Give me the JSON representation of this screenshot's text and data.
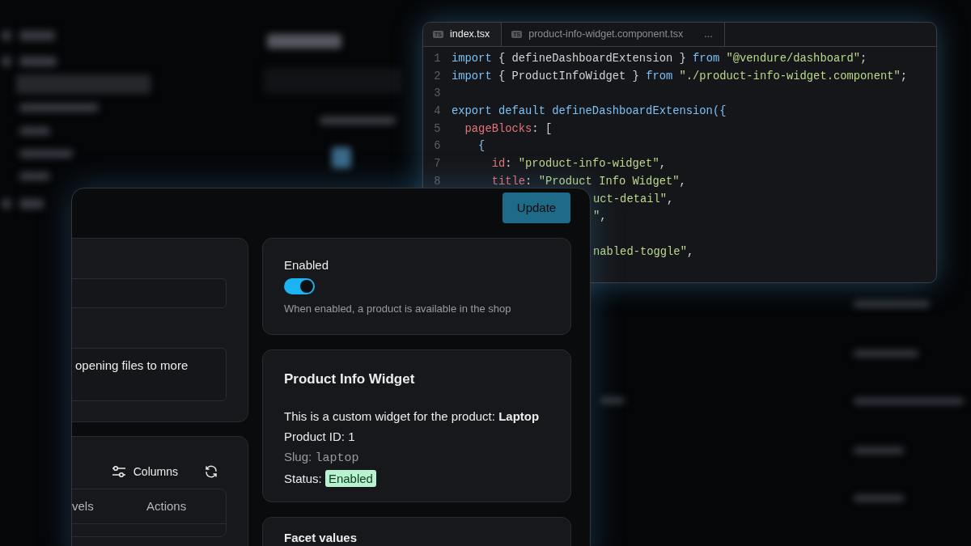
{
  "editor": {
    "tabs": [
      {
        "icon_label": "TS",
        "label": "index.tsx",
        "selected": true
      },
      {
        "icon_label": "TS",
        "label": "product-info-widget.component.tsx",
        "selected": false
      }
    ],
    "tab_overflow": "...",
    "lines": [
      {
        "kind": "full",
        "number": "1",
        "tokens": [
          {
            "kind": "keyword",
            "text": "import"
          },
          {
            "kind": "plain",
            "text": " { defineDashboardExtension } "
          },
          {
            "kind": "keyword",
            "text": "from"
          },
          {
            "kind": "string",
            "text": " \"@vendure/dashboard\""
          },
          {
            "kind": "plain",
            "text": ";"
          }
        ]
      },
      {
        "kind": "full",
        "number": "2",
        "tokens": [
          {
            "kind": "keyword",
            "text": "import"
          },
          {
            "kind": "plain",
            "text": " { ProductInfoWidget } "
          },
          {
            "kind": "keyword",
            "text": "from"
          },
          {
            "kind": "string",
            "text": " \"./product-info-widget.component\""
          },
          {
            "kind": "plain",
            "text": ";"
          }
        ]
      },
      {
        "kind": "full",
        "number": "3"
      },
      {
        "kind": "full",
        "number": "4",
        "tokens": [
          {
            "kind": "keyword",
            "text": "export default defineDashboardExtension({"
          }
        ]
      },
      {
        "kind": "full",
        "number": "5",
        "tokens": [
          {
            "kind": "property",
            "text": "  pageBlocks"
          },
          {
            "kind": "plain",
            "text": ": ["
          }
        ]
      },
      {
        "kind": "full",
        "number": "6",
        "tokens": [
          {
            "kind": "keyword",
            "text": "    {"
          }
        ]
      },
      {
        "kind": "full",
        "number": "7",
        "tokens": [
          {
            "kind": "property",
            "text": "      id"
          },
          {
            "kind": "plain",
            "text": ": "
          },
          {
            "kind": "string",
            "text": "\"product-info-widget\""
          },
          {
            "kind": "plain",
            "text": ","
          }
        ]
      },
      {
        "kind": "full",
        "number": "8",
        "tokens": [
          {
            "kind": "property",
            "text": "      title"
          },
          {
            "kind": "plain",
            "text": ": "
          },
          {
            "kind": "string",
            "text": "\"Product Info Widget\""
          },
          {
            "kind": "plain",
            "text": ","
          }
        ]
      },
      {
        "kind": "covered",
        "tokens": [
          {
            "kind": "string",
            "text": "uct-detail\""
          },
          {
            "kind": "plain",
            "text": ","
          }
        ]
      },
      {
        "kind": "covered",
        "tokens": [
          {
            "kind": "string",
            "text": "\""
          },
          {
            "kind": "plain",
            "text": ","
          }
        ]
      },
      {
        "kind": "covered"
      },
      {
        "kind": "covered",
        "tokens": [
          {
            "kind": "string",
            "text": "nabled-toggle\""
          },
          {
            "kind": "plain",
            "text": ","
          }
        ]
      }
    ]
  },
  "panel": {
    "update_button": "Update",
    "left": {
      "textarea_value": "opening files to more",
      "columns_button": "Columns",
      "table_headers": [
        "vels",
        "Actions"
      ]
    },
    "enabled_card": {
      "label": "Enabled",
      "on": true,
      "help": "When enabled, a product is available in the shop"
    },
    "widget": {
      "title": "Product Info Widget",
      "description": "This is a custom widget for the product: **Laptop**",
      "id_line": "Product ID: 1",
      "slug_label": "Slug:",
      "slug": "laptop",
      "status_label": "Status:",
      "status": "Enabled"
    },
    "facet_card": {
      "title": "Facet values"
    }
  }
}
